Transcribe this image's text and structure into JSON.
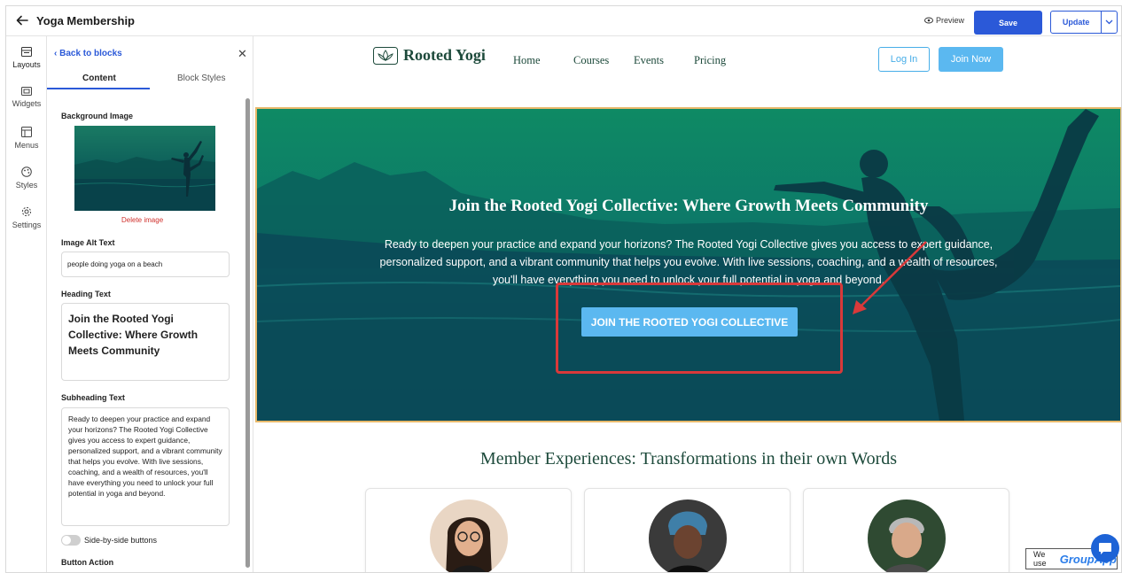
{
  "app": {
    "title": "Yoga Membership",
    "preview_label": "Preview",
    "save_label": "Save",
    "update_label": "Update"
  },
  "rail": {
    "items": [
      {
        "label": "Layouts",
        "icon": "layouts-icon"
      },
      {
        "label": "Widgets",
        "icon": "widgets-icon"
      },
      {
        "label": "Menus",
        "icon": "menus-icon"
      },
      {
        "label": "Styles",
        "icon": "palette-icon"
      },
      {
        "label": "Settings",
        "icon": "gear-icon"
      }
    ]
  },
  "panel": {
    "back_label": "Back to blocks",
    "tabs": [
      "Content",
      "Block Styles"
    ],
    "background_image_label": "Background Image",
    "delete_image_label": "Delete image",
    "alt_text_label": "Image Alt Text",
    "alt_text_value": "people doing yoga on a beach",
    "heading_label": "Heading Text",
    "heading_value": "Join the Rooted Yogi Collective: Where Growth Meets Community",
    "subheading_label": "Subheading Text",
    "subheading_value": "Ready to deepen your practice and expand your horizons? The Rooted Yogi Collective gives you access to expert guidance, personalized support, and a vibrant community that helps you evolve. With live sessions, coaching, and a wealth of resources, you'll have everything you need to unlock your full potential in yoga and beyond.",
    "toggle_label": "Side-by-side buttons",
    "button_action_label": "Button Action"
  },
  "site": {
    "logo_text": "Rooted Yogi",
    "nav": [
      "Home",
      "Courses",
      "Events",
      "Pricing"
    ],
    "login_label": "Log In",
    "join_label": "Join Now"
  },
  "hero": {
    "heading": "Join the Rooted Yogi Collective: Where Growth Meets Community",
    "subheading": "Ready to deepen your practice and expand your horizons? The Rooted Yogi Collective gives you access to expert guidance, personalized support, and a vibrant community that helps you evolve. With live sessions, coaching, and a wealth of resources, you'll have everything you need to unlock your full potential in yoga and beyond.",
    "cta_label": "JOIN THE ROOTED YOGI COLLECTIVE"
  },
  "testimonials": {
    "title": "Member Experiences: Transformations in their own Words"
  },
  "badge": {
    "prefix": "We use",
    "brand": "GroupApp"
  },
  "colors": {
    "primary": "#2b59d8",
    "cta": "#5bb8f0",
    "brand_green": "#1d4a3b",
    "hero_teal": "#0d7d68",
    "annotation_red": "#d9393a"
  }
}
